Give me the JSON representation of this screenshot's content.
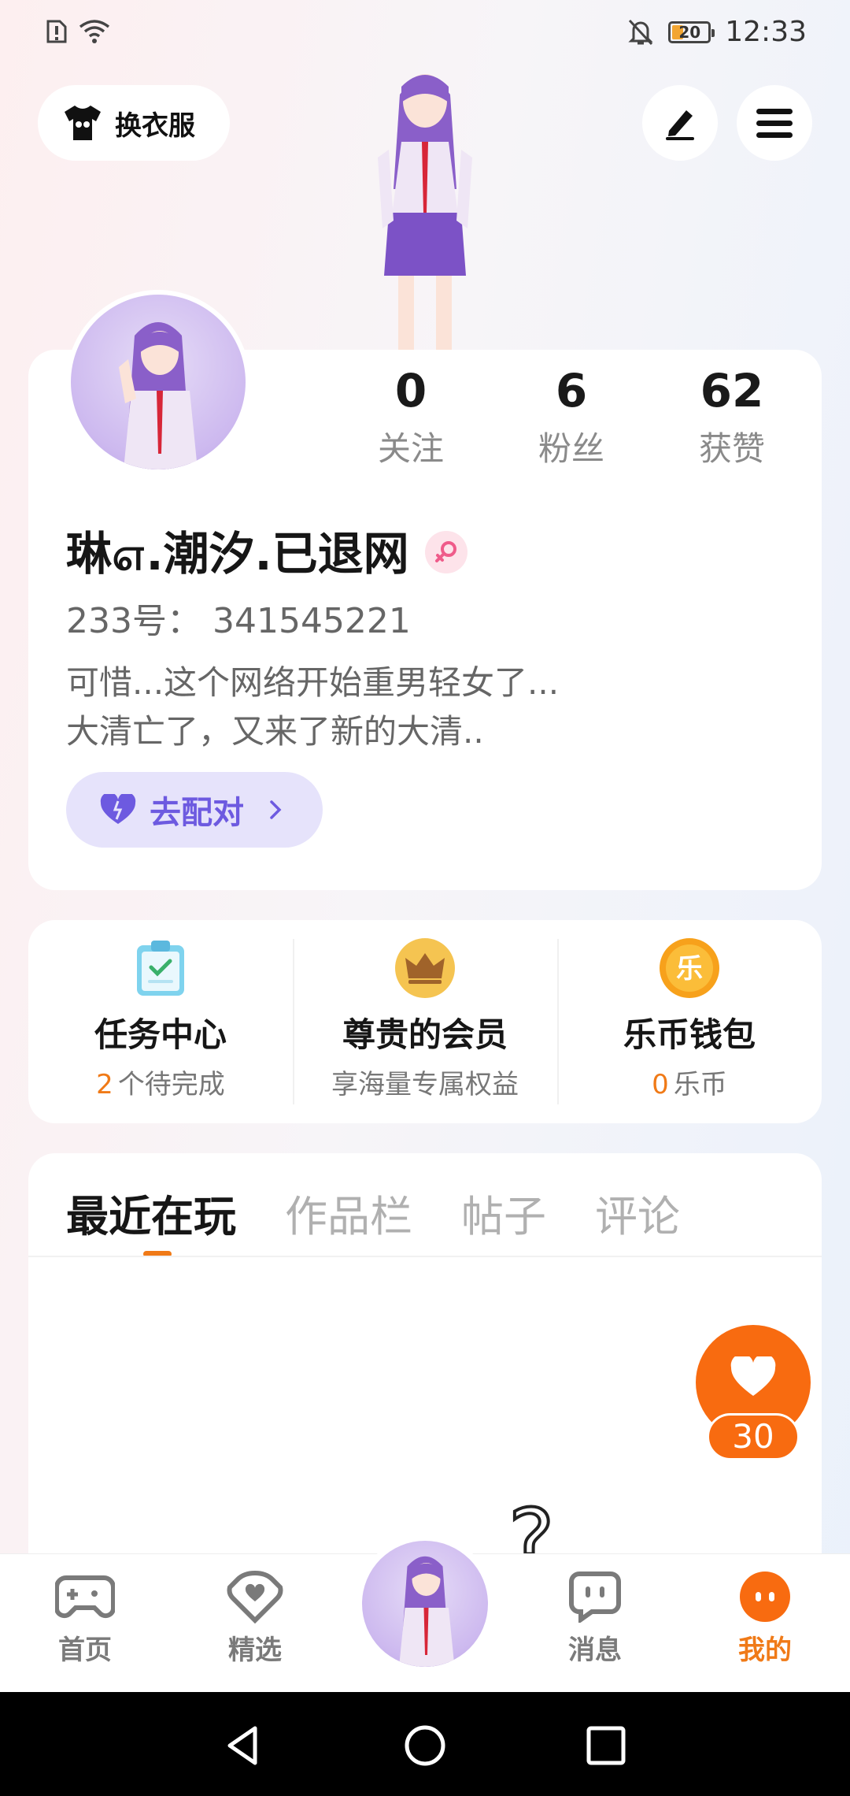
{
  "status_bar": {
    "time": "12:33",
    "battery": "20",
    "icons": [
      "alert-sim-icon",
      "wifi-icon",
      "mute-bell-icon",
      "battery-icon"
    ]
  },
  "top": {
    "dress_label": "换衣服",
    "dress_icon": "tshirt-icon",
    "edit_icon": "pencil-icon",
    "menu_icon": "hamburger-menu-icon"
  },
  "profile": {
    "stats": [
      {
        "value": "0",
        "label": "关注"
      },
      {
        "value": "6",
        "label": "粉丝"
      },
      {
        "value": "62",
        "label": "获赞"
      }
    ],
    "nickname": "琳௭.潮汐.已退网",
    "gender_icon": "female-icon",
    "uid": "233号： 341545221",
    "bio_line1": "可惜...这个网络开始重男轻女了...",
    "bio_line2": "大清亡了，又来了新的大清..",
    "match_label": "去配对"
  },
  "features": [
    {
      "title": "任务中心",
      "count": "2",
      "sub": "个待完成",
      "icon": "clipboard-check-icon"
    },
    {
      "title": "尊贵的会员",
      "sub": "享海量专属权益",
      "icon": "crown-icon"
    },
    {
      "title": "乐币钱包",
      "count": "0",
      "sub": "乐币",
      "icon": "coin-icon",
      "coin_char": "乐"
    }
  ],
  "tabs": [
    "最近在玩",
    "作品栏",
    "帖子",
    "评论"
  ],
  "fab": {
    "count": "30",
    "icon": "heart-icon"
  },
  "bottom_nav": [
    {
      "label": "首页",
      "icon": "gamepad-icon"
    },
    {
      "label": "精选",
      "icon": "heart-badge-icon"
    },
    {
      "label": "消息",
      "icon": "chat-icon"
    },
    {
      "label": "我的",
      "icon": "me-dots-icon",
      "active": true
    }
  ],
  "colors": {
    "accent": "#f07a17",
    "fab": "#f86b10",
    "match_bg": "#e6e3fb",
    "match_text": "#6d5ae0"
  }
}
